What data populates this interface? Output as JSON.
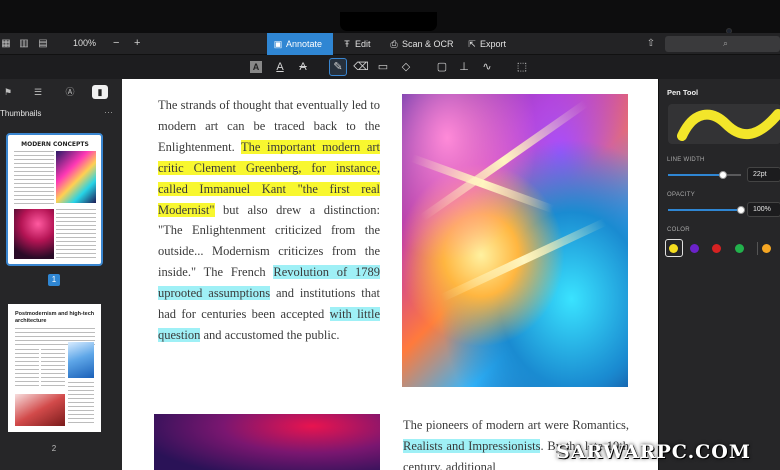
{
  "topbar": {
    "zoom": "100%",
    "tabs": [
      {
        "label": "Annotate",
        "icon": "annotate-icon"
      },
      {
        "label": "Edit",
        "icon": "edit-icon"
      },
      {
        "label": "Scan & OCR",
        "icon": "scan-icon"
      },
      {
        "label": "Export",
        "icon": "export-icon"
      }
    ],
    "active_tab": "Annotate"
  },
  "sidebar": {
    "title": "Thumbnails",
    "pages": [
      "1",
      "2"
    ],
    "thumb1_title": "MODERN CONCEPTS",
    "thumb2_title": "Postmodernism and high-tech architecture"
  },
  "document": {
    "para1": [
      {
        "t": "The strands of thought that eventually led to modern art can be traced back to the Enlightenment. ",
        "h": ""
      },
      {
        "t": "The important modern art critic Clement Greenberg, for instance, called Immanuel Kant \"the first real Modernist\"",
        "h": "yellow"
      },
      {
        "t": " but also drew a distinction: \"The Enlightenment criticized from the outside... Modernism criticizes from the inside.\" The French ",
        "h": ""
      },
      {
        "t": "Revolution of 1789 uprooted assumptions",
        "h": "cyan"
      },
      {
        "t": " and institutions that had for centuries been accepted ",
        "h": ""
      },
      {
        "t": "with little question",
        "h": "cyan"
      },
      {
        "t": " and accustomed the public.",
        "h": ""
      }
    ],
    "para2": [
      {
        "t": "The pioneers of modern art were Romantics, ",
        "h": ""
      },
      {
        "t": "Realists and Impressionists",
        "h": "cyan"
      },
      {
        "t": ". By the late 19th century, additional",
        "h": ""
      }
    ]
  },
  "right_panel": {
    "title": "Pen Tool",
    "line_width_label": "LINE WIDTH",
    "line_width_value": "22pt",
    "line_width_fraction": 0.75,
    "opacity_label": "OPACITY",
    "opacity_value": "100%",
    "opacity_fraction": 1.0,
    "color_label": "COLOR",
    "colors": [
      "#f5dd1f",
      "#6b22c9",
      "#d62222",
      "#22b14c",
      "#f5a623"
    ],
    "selected_color": "#f5dd1f",
    "stroke_color": "#f3e62a"
  },
  "watermark": "SARWARPC.COM"
}
